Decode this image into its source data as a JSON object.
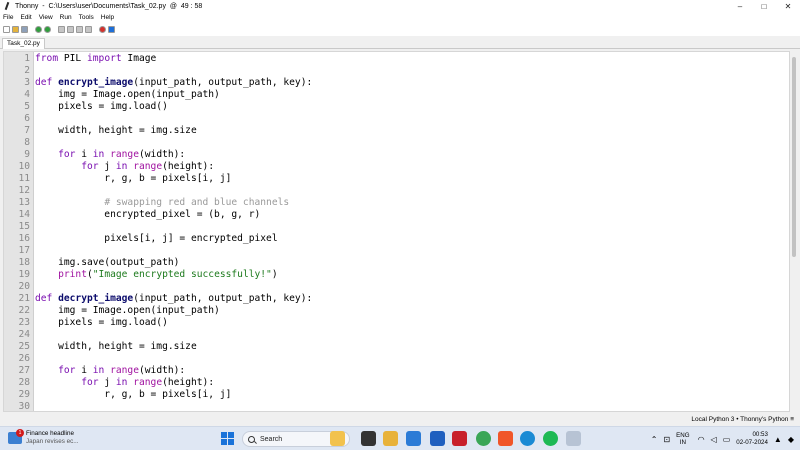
{
  "window": {
    "title": "Thonny  -  C:\\Users\\user\\Documents\\Task_02.py  @  49 : 58",
    "controls": {
      "minimize": "–",
      "maximize": "□",
      "close": "✕"
    }
  },
  "menu": [
    "File",
    "Edit",
    "View",
    "Run",
    "Tools",
    "Help"
  ],
  "toolbar_icons": [
    {
      "name": "new-file-icon",
      "color": "#ffffff"
    },
    {
      "name": "open-file-icon",
      "color": "#e3b33d"
    },
    {
      "name": "save-file-icon",
      "color": "#8ea0b8"
    },
    {
      "name": "run-icon",
      "color": "#2f9e3c"
    },
    {
      "name": "debug-icon",
      "color": "#2f9e3c"
    },
    {
      "name": "step-over-icon",
      "color": "#c6c6c6"
    },
    {
      "name": "step-into-icon",
      "color": "#c6c6c6"
    },
    {
      "name": "step-out-icon",
      "color": "#c6c6c6"
    },
    {
      "name": "resume-icon",
      "color": "#c6c6c6"
    },
    {
      "name": "stop-icon",
      "color": "#d4302c"
    },
    {
      "name": "support-ukraine-icon",
      "color": "#1e6fd8"
    }
  ],
  "tab": {
    "label": "Task_02.py"
  },
  "code_lines": [
    {
      "n": "1",
      "parts": [
        {
          "t": "from",
          "c": "kw"
        },
        {
          "t": " PIL ",
          "c": ""
        },
        {
          "t": "import",
          "c": "kw"
        },
        {
          "t": " Image",
          "c": ""
        }
      ]
    },
    {
      "n": "2",
      "parts": []
    },
    {
      "n": "3",
      "parts": [
        {
          "t": "def",
          "c": "kw"
        },
        {
          "t": " ",
          "c": ""
        },
        {
          "t": "encrypt_image",
          "c": "fn"
        },
        {
          "t": "(input_path, output_path, key):",
          "c": ""
        }
      ]
    },
    {
      "n": "4",
      "parts": [
        {
          "t": "    img = Image.open(input_path)",
          "c": ""
        }
      ]
    },
    {
      "n": "5",
      "parts": [
        {
          "t": "    pixels = img.load()",
          "c": ""
        }
      ]
    },
    {
      "n": "6",
      "parts": []
    },
    {
      "n": "7",
      "parts": [
        {
          "t": "    width, height = img.size",
          "c": ""
        }
      ]
    },
    {
      "n": "8",
      "parts": []
    },
    {
      "n": "9",
      "parts": [
        {
          "t": "    ",
          "c": ""
        },
        {
          "t": "for",
          "c": "kw"
        },
        {
          "t": " i ",
          "c": ""
        },
        {
          "t": "in",
          "c": "kw"
        },
        {
          "t": " ",
          "c": ""
        },
        {
          "t": "range",
          "c": "bi"
        },
        {
          "t": "(width):",
          "c": ""
        }
      ]
    },
    {
      "n": "10",
      "parts": [
        {
          "t": "        ",
          "c": ""
        },
        {
          "t": "for",
          "c": "kw"
        },
        {
          "t": " j ",
          "c": ""
        },
        {
          "t": "in",
          "c": "kw"
        },
        {
          "t": " ",
          "c": ""
        },
        {
          "t": "range",
          "c": "bi"
        },
        {
          "t": "(height):",
          "c": ""
        }
      ]
    },
    {
      "n": "11",
      "parts": [
        {
          "t": "            r, g, b = pixels[i, j]",
          "c": ""
        }
      ]
    },
    {
      "n": "12",
      "parts": []
    },
    {
      "n": "13",
      "parts": [
        {
          "t": "            ",
          "c": ""
        },
        {
          "t": "# swapping red and blue channels",
          "c": "cm"
        }
      ]
    },
    {
      "n": "14",
      "parts": [
        {
          "t": "            encrypted_pixel = (b, g, r)",
          "c": ""
        }
      ]
    },
    {
      "n": "15",
      "parts": []
    },
    {
      "n": "16",
      "parts": [
        {
          "t": "            pixels[i, j] = encrypted_pixel",
          "c": ""
        }
      ]
    },
    {
      "n": "17",
      "parts": []
    },
    {
      "n": "18",
      "parts": [
        {
          "t": "    img.save(output_path)",
          "c": ""
        }
      ]
    },
    {
      "n": "19",
      "parts": [
        {
          "t": "    ",
          "c": ""
        },
        {
          "t": "print",
          "c": "bi"
        },
        {
          "t": "(",
          "c": ""
        },
        {
          "t": "\"Image encrypted successfully!\"",
          "c": "str"
        },
        {
          "t": ")",
          "c": ""
        }
      ]
    },
    {
      "n": "20",
      "parts": []
    },
    {
      "n": "21",
      "parts": [
        {
          "t": "def",
          "c": "kw"
        },
        {
          "t": " ",
          "c": ""
        },
        {
          "t": "decrypt_image",
          "c": "fn"
        },
        {
          "t": "(input_path, output_path, key):",
          "c": ""
        }
      ]
    },
    {
      "n": "22",
      "parts": [
        {
          "t": "    img = Image.open(input_path)",
          "c": ""
        }
      ]
    },
    {
      "n": "23",
      "parts": [
        {
          "t": "    pixels = img.load()",
          "c": ""
        }
      ]
    },
    {
      "n": "24",
      "parts": []
    },
    {
      "n": "25",
      "parts": [
        {
          "t": "    width, height = img.size",
          "c": ""
        }
      ]
    },
    {
      "n": "26",
      "parts": []
    },
    {
      "n": "27",
      "parts": [
        {
          "t": "    ",
          "c": ""
        },
        {
          "t": "for",
          "c": "kw"
        },
        {
          "t": " i ",
          "c": ""
        },
        {
          "t": "in",
          "c": "kw"
        },
        {
          "t": " ",
          "c": ""
        },
        {
          "t": "range",
          "c": "bi"
        },
        {
          "t": "(width):",
          "c": ""
        }
      ]
    },
    {
      "n": "28",
      "parts": [
        {
          "t": "        ",
          "c": ""
        },
        {
          "t": "for",
          "c": "kw"
        },
        {
          "t": " j ",
          "c": ""
        },
        {
          "t": "in",
          "c": "kw"
        },
        {
          "t": " ",
          "c": ""
        },
        {
          "t": "range",
          "c": "bi"
        },
        {
          "t": "(height):",
          "c": ""
        }
      ]
    },
    {
      "n": "29",
      "parts": [
        {
          "t": "            r, g, b = pixels[i, j]",
          "c": ""
        }
      ]
    },
    {
      "n": "30",
      "parts": []
    }
  ],
  "statusbar": {
    "interpreter": "Local Python 3  •  Thonny's Python  ≡"
  },
  "taskbar": {
    "news_title": "Finance headline",
    "news_subtitle": "Japan revises ec...",
    "news_badge": "1",
    "search_label": "Search",
    "apps": [
      {
        "name": "file-explorer-icon",
        "color": "#f2c24d"
      },
      {
        "name": "terminal-icon",
        "color": "#333333"
      },
      {
        "name": "folder-icon",
        "color": "#e8b23a"
      },
      {
        "name": "store-icon",
        "color": "#2b7bd6"
      },
      {
        "name": "sketch-app-icon",
        "color": "#1f5fbf"
      },
      {
        "name": "mcafee-icon",
        "color": "#c8202b"
      },
      {
        "name": "chrome-icon",
        "color": "#3aa657"
      },
      {
        "name": "brave-icon",
        "color": "#f0562a"
      },
      {
        "name": "edge-icon",
        "color": "#1a8ad4"
      },
      {
        "name": "spotify-icon",
        "color": "#1db954"
      },
      {
        "name": "thonny-icon",
        "color": "#b7c3d4"
      }
    ],
    "lang_top": "ENG",
    "lang_bottom": "IN",
    "time": "00:53",
    "date": "02-07-2024"
  }
}
